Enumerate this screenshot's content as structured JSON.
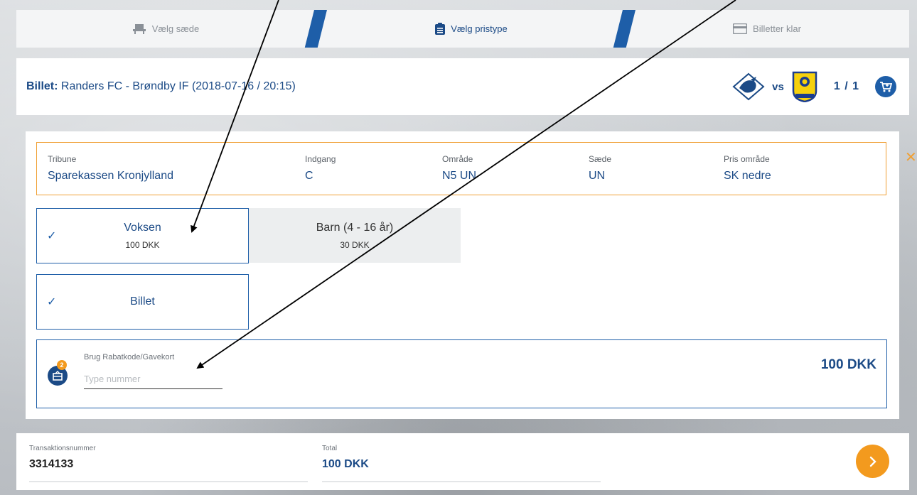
{
  "steps": [
    {
      "label": "Vælg sæde",
      "icon": "seat-icon"
    },
    {
      "label": "Vælg pristype",
      "icon": "clipboard-icon"
    },
    {
      "label": "Billetter klar",
      "icon": "ticket-card-icon"
    }
  ],
  "ticket": {
    "prefix": "Billet:",
    "title": "Randers FC - Brøndby IF (2018-07-16 / 20:15)",
    "vs": "vs",
    "count": "1 / 1",
    "home_logo": "randers-fc-logo",
    "away_logo": "brondby-if-logo"
  },
  "seat": {
    "tribune_label": "Tribune",
    "tribune": "Sparekassen Kronjylland",
    "indgang_label": "Indgang",
    "indgang": "C",
    "omraade_label": "Område",
    "omraade": "N5 UN",
    "saede_label": "Sæde",
    "saede": "UN",
    "pris_label": "Pris område",
    "pris": "SK nedre"
  },
  "close_symbol": "✕",
  "price_options": [
    {
      "name": "Voksen",
      "price": "100 DKK",
      "selected": true
    },
    {
      "name": "Barn (4 - 16 år)",
      "price": "30 DKK",
      "selected": false
    }
  ],
  "ticket_type": {
    "name": "Billet",
    "selected": true
  },
  "discount": {
    "label": "Brug Rabatkode/Gavekort",
    "placeholder": "Type nummer",
    "badge": "2",
    "price": "100 DKK"
  },
  "footer": {
    "transaction_label": "Transaktionsnummer",
    "transaction": "3314133",
    "total_label": "Total",
    "total": "100 DKK"
  },
  "colors": {
    "brand_blue": "#1b4a86",
    "accent_orange": "#f39a1e",
    "border_orange": "#f0a035"
  }
}
